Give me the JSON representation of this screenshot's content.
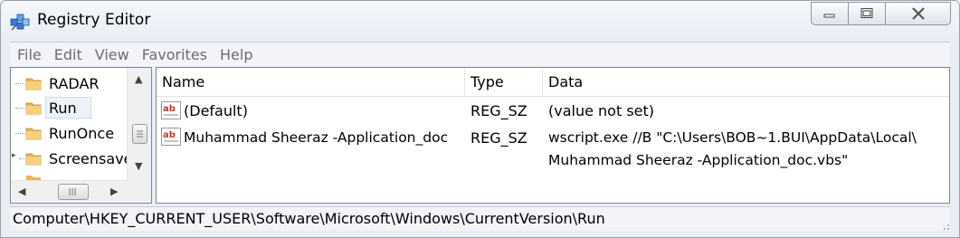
{
  "window": {
    "title": "Registry Editor",
    "controls": {
      "minimize": "minimize",
      "maximize": "maximize",
      "close": "close"
    }
  },
  "menu": [
    "File",
    "Edit",
    "View",
    "Favorites",
    "Help"
  ],
  "tree": {
    "items": [
      {
        "label": "RADAR",
        "selected": false
      },
      {
        "label": "Run",
        "selected": true
      },
      {
        "label": "RunOnce",
        "selected": false
      },
      {
        "label": "Screensave",
        "selected": false
      }
    ]
  },
  "values": {
    "columns": [
      "Name",
      "Type",
      "Data"
    ],
    "rows": [
      {
        "name": "(Default)",
        "type": "REG_SZ",
        "data_line1": "(value not set)",
        "data_line2": ""
      },
      {
        "name": "Muhammad Sheeraz -Application_doc",
        "type": "REG_SZ",
        "data_line1": "wscript.exe //B \"C:\\Users\\BOB~1.BUI\\AppData\\Local\\",
        "data_line2": "Muhammad Sheeraz -Application_doc.vbs\""
      }
    ]
  },
  "status": {
    "path": "Computer\\HKEY_CURRENT_USER\\Software\\Microsoft\\Windows\\CurrentVersion\\Run"
  },
  "colors": {
    "window_bg": "#e9eef4",
    "folder_yellow": "#e8b84a",
    "ab_red": "#c0392b"
  },
  "icons": {
    "app": "registry-editor-icon",
    "folder": "folder-icon",
    "string_value": "string-value-icon"
  }
}
